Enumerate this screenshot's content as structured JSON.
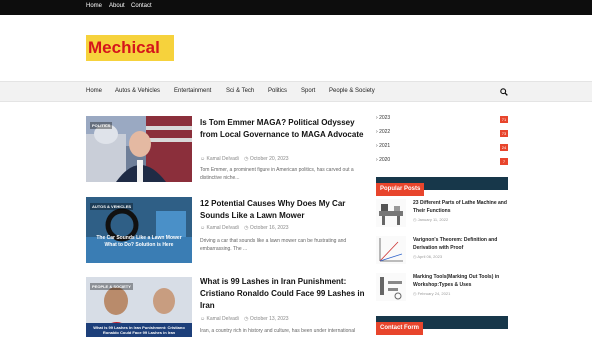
{
  "topbar": {
    "links": [
      "Home",
      "About",
      "Contact"
    ]
  },
  "header": {
    "logo": "Mechical"
  },
  "nav": {
    "items": [
      "Home",
      "Autos & Vehicles",
      "Entertainment",
      "Sci & Tech",
      "Politics",
      "Sport",
      "People & Society"
    ]
  },
  "posts": [
    {
      "tag": "POLITICS",
      "title": "Is Tom Emmer MAGA? Political Odyssey from Local Governance to MAGA Advocate",
      "author": "Kamal Delvadi",
      "date": "October 20, 2023",
      "excerpt": "Tom Emmer, a prominent figure in American politics, has carved out a distinctive niche..."
    },
    {
      "tag": "AUTOS & VEHICLES",
      "image_caption": "The Car Sounds Like a Lawn Mower What to Do? Solution is Here",
      "title": "12 Potential Causes Why Does My Car Sounds Like a Lawn Mower",
      "author": "Kamal Delvadi",
      "date": "October 16, 2023",
      "excerpt": "Driving a car that sounds like a lawn mower can be frustrating and embarrassing. The ..."
    },
    {
      "tag": "PEOPLE & SOCIETY",
      "image_caption": "What is 99 Lashes in Iran Punishment: Cristiano Ronaldo Could Face 99 Lashes in Iran",
      "title": "What is 99 Lashes in Iran Punishment: Cristiano Ronaldo Could Face 99 Lashes in Iran",
      "author": "Kamal Delvadi",
      "date": "October 13, 2023",
      "excerpt": "Iran, a country rich in history and culture, has been under international"
    }
  ],
  "archive": [
    {
      "year": "2023",
      "count": "71"
    },
    {
      "year": "2022",
      "count": "73"
    },
    {
      "year": "2021",
      "count": "24"
    },
    {
      "year": "2020",
      "count": "7"
    }
  ],
  "popular": {
    "title": "Popular Posts",
    "items": [
      {
        "title": "23 Different Parts of Lathe Machine and Their Functions",
        "date": "January 11, 2022"
      },
      {
        "title": "Varignon's Theorem: Definition and Derivation with Proof",
        "date": "April 06, 2023"
      },
      {
        "title": "Marking Tools(Marking Out Tools) in Workshop:Types & Uses",
        "date": "February 24, 2021"
      }
    ]
  },
  "contact": {
    "title": "Contact Form"
  },
  "colors": {
    "accent": "#e8452c",
    "dark": "#17374a",
    "logo_bg": "#f6d23c",
    "logo_text": "#d5151b"
  }
}
